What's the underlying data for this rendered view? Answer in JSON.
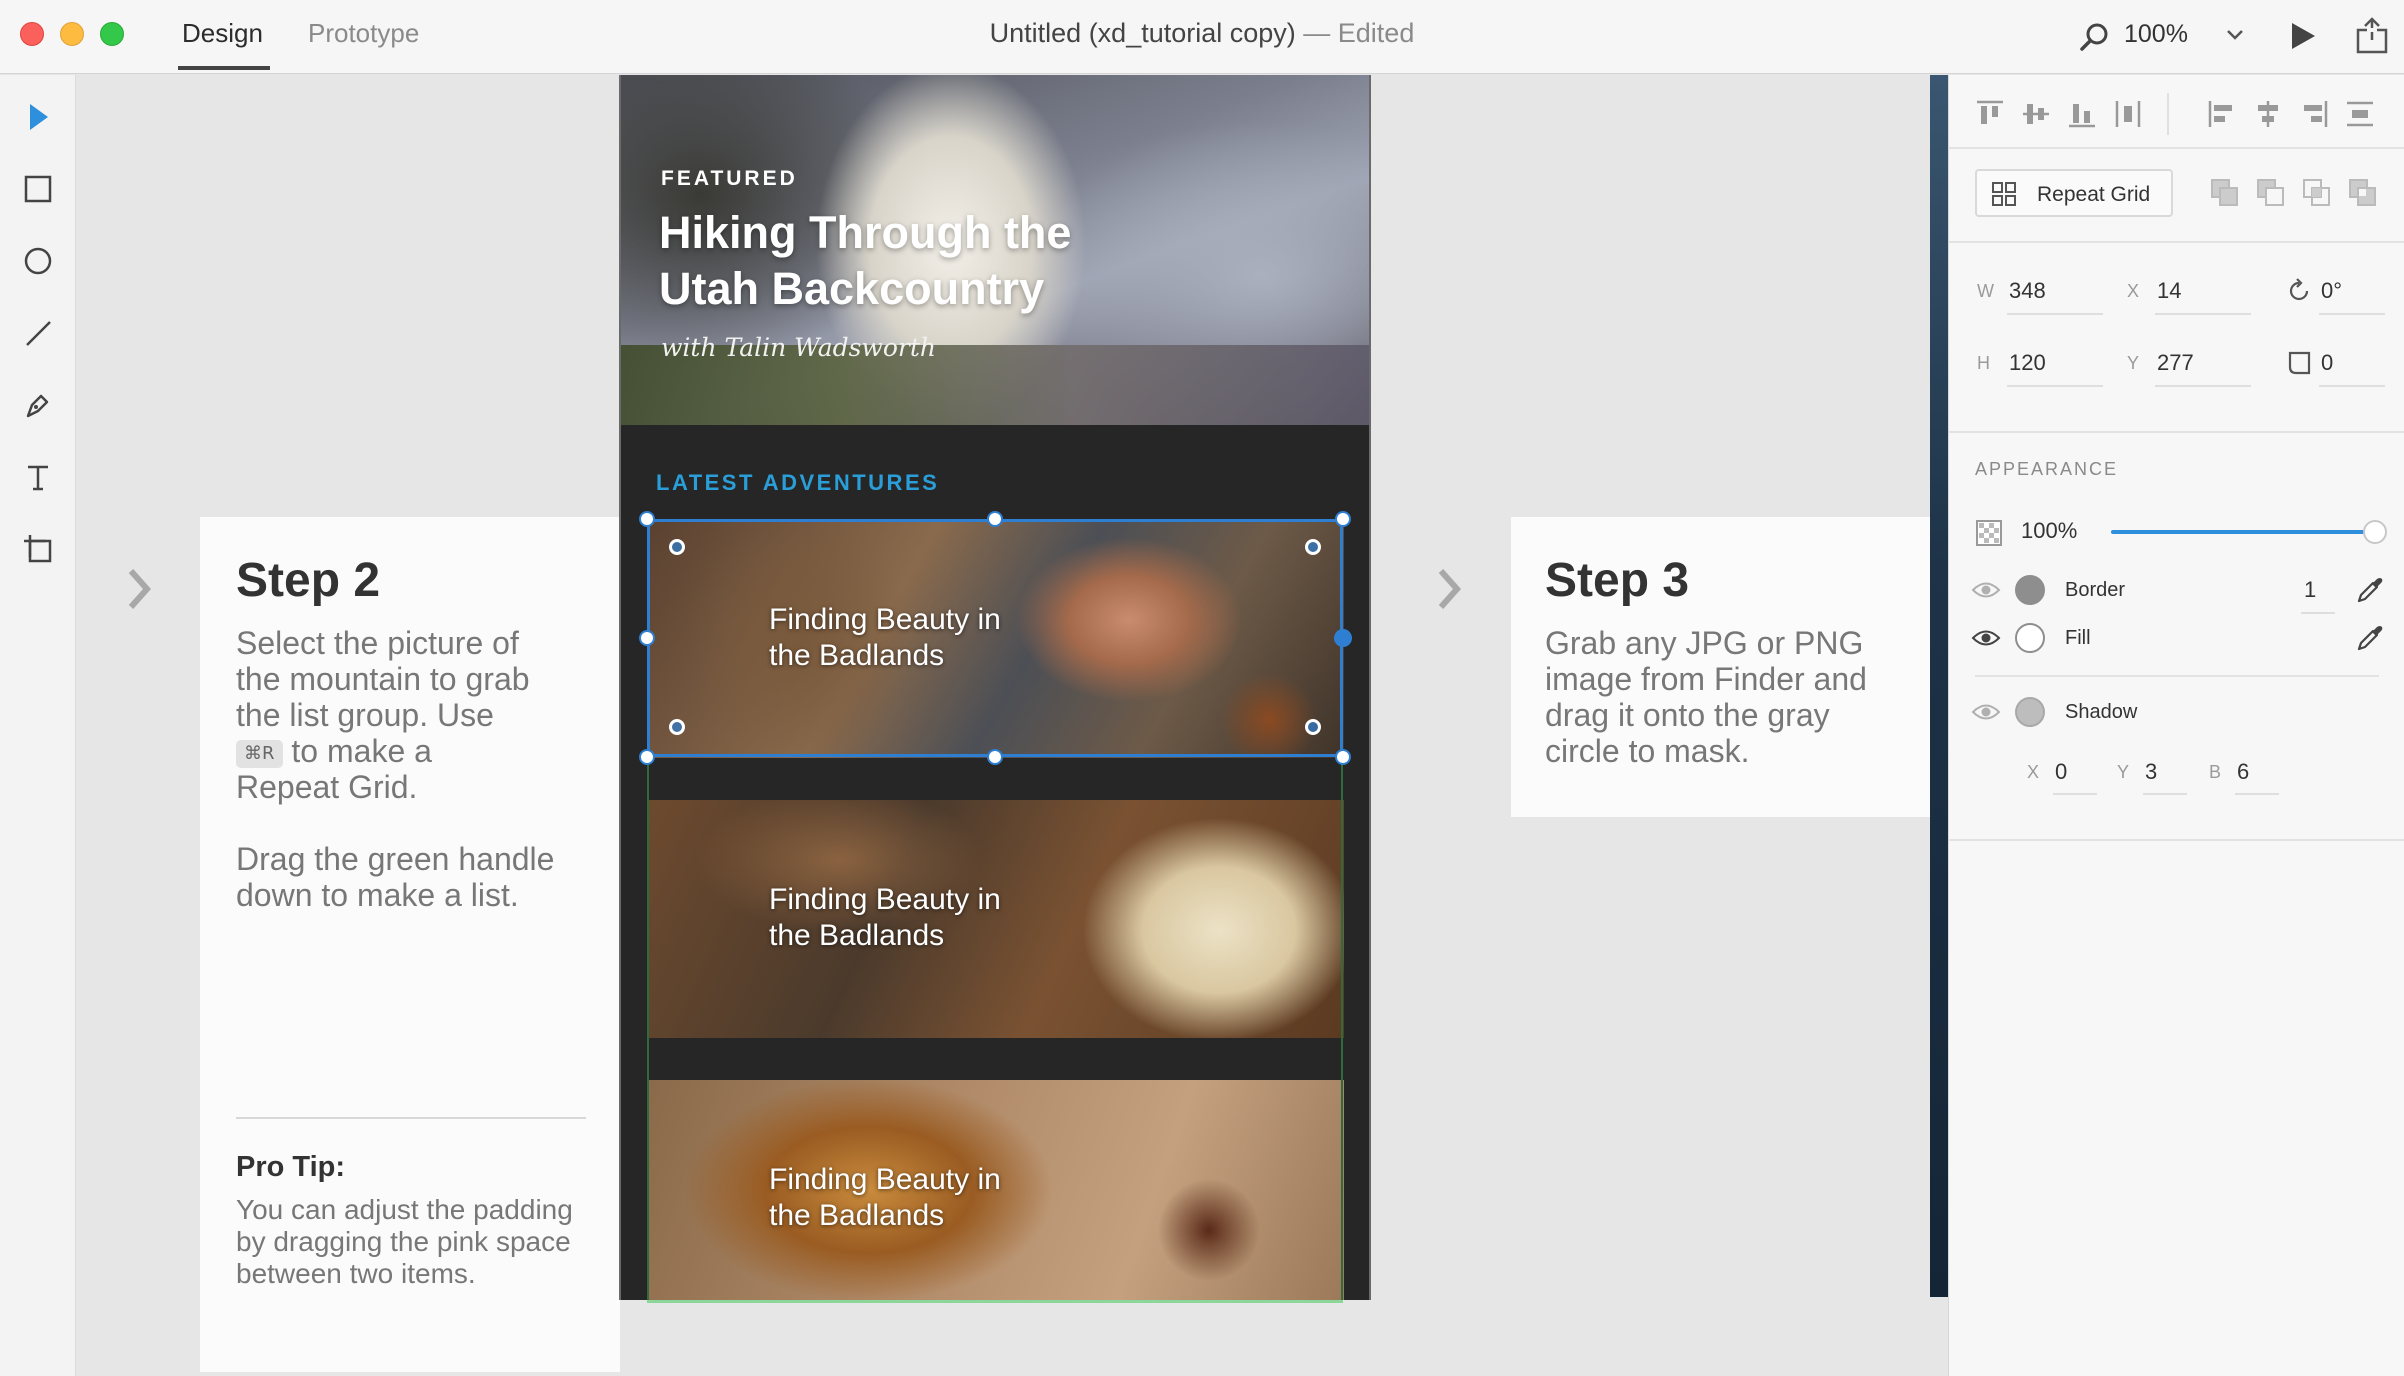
{
  "window": {
    "tabs": [
      {
        "label": "Design",
        "active": true
      },
      {
        "label": "Prototype",
        "active": false
      }
    ],
    "title": "Untitled (xd_tutorial copy)",
    "title_suffix": " — Edited",
    "zoom": "100%"
  },
  "tools": [
    {
      "name": "select-tool",
      "icon": "arrow-pointer-icon",
      "active": true
    },
    {
      "name": "rectangle-tool",
      "icon": "rectangle-icon"
    },
    {
      "name": "ellipse-tool",
      "icon": "ellipse-icon"
    },
    {
      "name": "line-tool",
      "icon": "line-icon"
    },
    {
      "name": "pen-tool",
      "icon": "pen-icon"
    },
    {
      "name": "text-tool",
      "icon": "text-icon"
    },
    {
      "name": "artboard-tool",
      "icon": "artboard-icon"
    }
  ],
  "step2": {
    "title": "Step 2",
    "body_line1": "Select the picture of",
    "body_line2": "the mountain to grab",
    "body_line3": "the list group. Use",
    "shortcut": "⌘R",
    "body_line4": "to make a",
    "body_line5": "Repeat Grid.",
    "body_line6": "Drag the green handle",
    "body_line7": "down to make a list.",
    "pro_tip_title": "Pro Tip:",
    "pro_tip_body": "You can adjust the padding by dragging the pink space between two items."
  },
  "step3": {
    "title": "Step 3",
    "body": "Grab any JPG or PNG image from Finder and drag it onto the gray circle to mask."
  },
  "artboard": {
    "featured_label": "FEATURED",
    "hero_title_line1": "Hiking Through the",
    "hero_title_line2": "Utah Backcountry",
    "hero_subtitle": "with Talin Wadsworth",
    "section_label": "LATEST ADVENTURES",
    "cards": [
      {
        "title": "Finding Beauty in the Badlands"
      },
      {
        "title": "Finding Beauty in the Badlands"
      },
      {
        "title": "Finding Beauty in the Badlands"
      }
    ]
  },
  "inspector": {
    "repeat_grid_label": "Repeat Grid",
    "w_label": "W",
    "w": "348",
    "x_label": "X",
    "x": "14",
    "rotation": "0°",
    "h_label": "H",
    "h": "120",
    "y_label": "Y",
    "y": "277",
    "radius": "0",
    "appearance_label": "APPEARANCE",
    "opacity": "100%",
    "opacity_fraction": 1.0,
    "border_label": "Border",
    "border_width": "1",
    "fill_label": "Fill",
    "shadow_label": "Shadow",
    "shadow_x_label": "X",
    "shadow_x": "0",
    "shadow_y_label": "Y",
    "shadow_y": "3",
    "shadow_b_label": "B",
    "shadow_b": "6"
  },
  "colors": {
    "accent_blue": "#2e8fdc",
    "section_label_blue": "#2a9ed8",
    "selection_green": "#2e6b3d",
    "handle_green": "#8dd69a"
  }
}
